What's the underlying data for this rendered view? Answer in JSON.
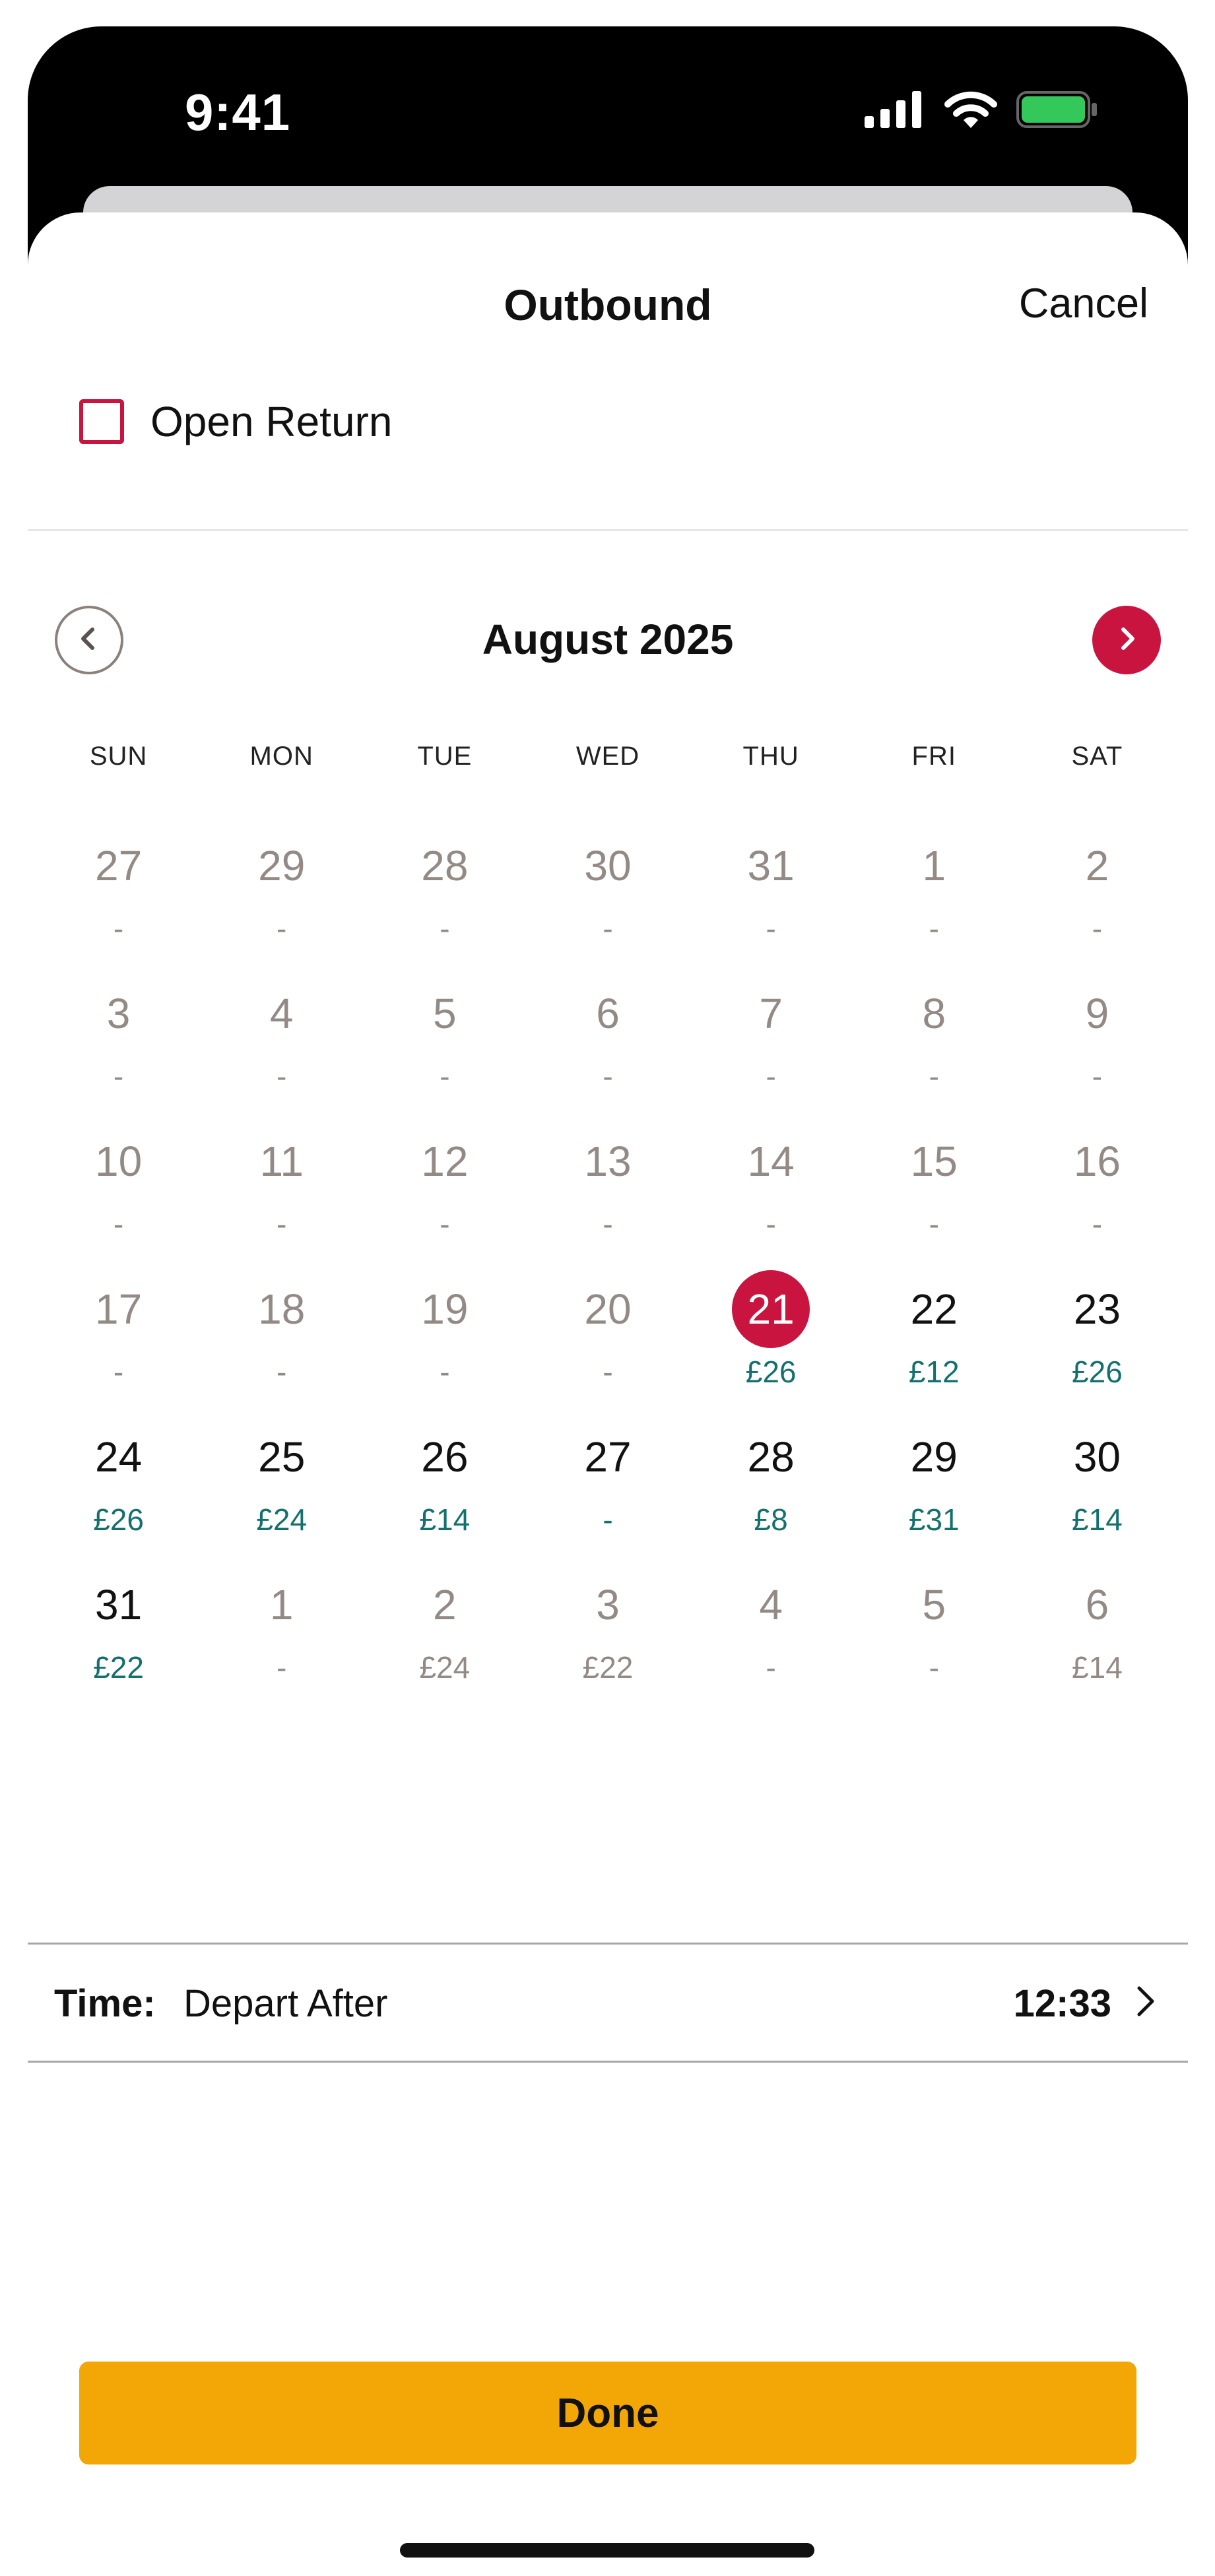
{
  "status_bar": {
    "time": "9:41"
  },
  "header": {
    "title": "Outbound",
    "cancel_label": "Cancel"
  },
  "open_return": {
    "label": "Open Return",
    "checked": false
  },
  "calendar": {
    "month_label": "August 2025",
    "weekdays": [
      "SUN",
      "MON",
      "TUE",
      "WED",
      "THU",
      "FRI",
      "SAT"
    ],
    "days": [
      {
        "day": "27",
        "price": "-",
        "state": "disabled"
      },
      {
        "day": "29",
        "price": "-",
        "state": "disabled"
      },
      {
        "day": "28",
        "price": "-",
        "state": "disabled"
      },
      {
        "day": "30",
        "price": "-",
        "state": "disabled"
      },
      {
        "day": "31",
        "price": "-",
        "state": "disabled"
      },
      {
        "day": "1",
        "price": "-",
        "state": "disabled"
      },
      {
        "day": "2",
        "price": "-",
        "state": "disabled"
      },
      {
        "day": "3",
        "price": "-",
        "state": "disabled"
      },
      {
        "day": "4",
        "price": "-",
        "state": "disabled"
      },
      {
        "day": "5",
        "price": "-",
        "state": "disabled"
      },
      {
        "day": "6",
        "price": "-",
        "state": "disabled"
      },
      {
        "day": "7",
        "price": "-",
        "state": "disabled"
      },
      {
        "day": "8",
        "price": "-",
        "state": "disabled"
      },
      {
        "day": "9",
        "price": "-",
        "state": "disabled"
      },
      {
        "day": "10",
        "price": "-",
        "state": "disabled"
      },
      {
        "day": "11",
        "price": "-",
        "state": "disabled"
      },
      {
        "day": "12",
        "price": "-",
        "state": "disabled"
      },
      {
        "day": "13",
        "price": "-",
        "state": "disabled"
      },
      {
        "day": "14",
        "price": "-",
        "state": "disabled"
      },
      {
        "day": "15",
        "price": "-",
        "state": "disabled"
      },
      {
        "day": "16",
        "price": "-",
        "state": "disabled"
      },
      {
        "day": "17",
        "price": "-",
        "state": "disabled"
      },
      {
        "day": "18",
        "price": "-",
        "state": "disabled"
      },
      {
        "day": "19",
        "price": "-",
        "state": "disabled"
      },
      {
        "day": "20",
        "price": "-",
        "state": "disabled"
      },
      {
        "day": "21",
        "price": "£26",
        "state": "selected"
      },
      {
        "day": "22",
        "price": "£12",
        "state": "active"
      },
      {
        "day": "23",
        "price": "£26",
        "state": "active"
      },
      {
        "day": "24",
        "price": "£26",
        "state": "active"
      },
      {
        "day": "25",
        "price": "£24",
        "state": "active"
      },
      {
        "day": "26",
        "price": "£14",
        "state": "active"
      },
      {
        "day": "27",
        "price": "-",
        "state": "active"
      },
      {
        "day": "28",
        "price": "£8",
        "state": "active"
      },
      {
        "day": "29",
        "price": "£31",
        "state": "active"
      },
      {
        "day": "30",
        "price": "£14",
        "state": "active"
      },
      {
        "day": "31",
        "price": "£22",
        "state": "active"
      },
      {
        "day": "1",
        "price": "-",
        "state": "disabled"
      },
      {
        "day": "2",
        "price": "£24",
        "state": "disabled"
      },
      {
        "day": "3",
        "price": "£22",
        "state": "disabled"
      },
      {
        "day": "4",
        "price": "-",
        "state": "disabled"
      },
      {
        "day": "5",
        "price": "-",
        "state": "disabled"
      },
      {
        "day": "6",
        "price": "£14",
        "state": "disabled"
      }
    ]
  },
  "time_row": {
    "label": "Time:",
    "mode": "Depart After",
    "value": "12:33"
  },
  "done_label": "Done",
  "colors": {
    "accent": "#c8143f",
    "price": "#14706e",
    "muted": "#948a85",
    "done_button": "#f2a707",
    "battery": "#34c759"
  },
  "icons": {
    "prev": "chevron-left-icon",
    "next": "chevron-right-icon",
    "time": "chevron-right-icon",
    "signal": "cellular-signal-icon",
    "wifi": "wifi-icon",
    "battery": "battery-icon"
  }
}
